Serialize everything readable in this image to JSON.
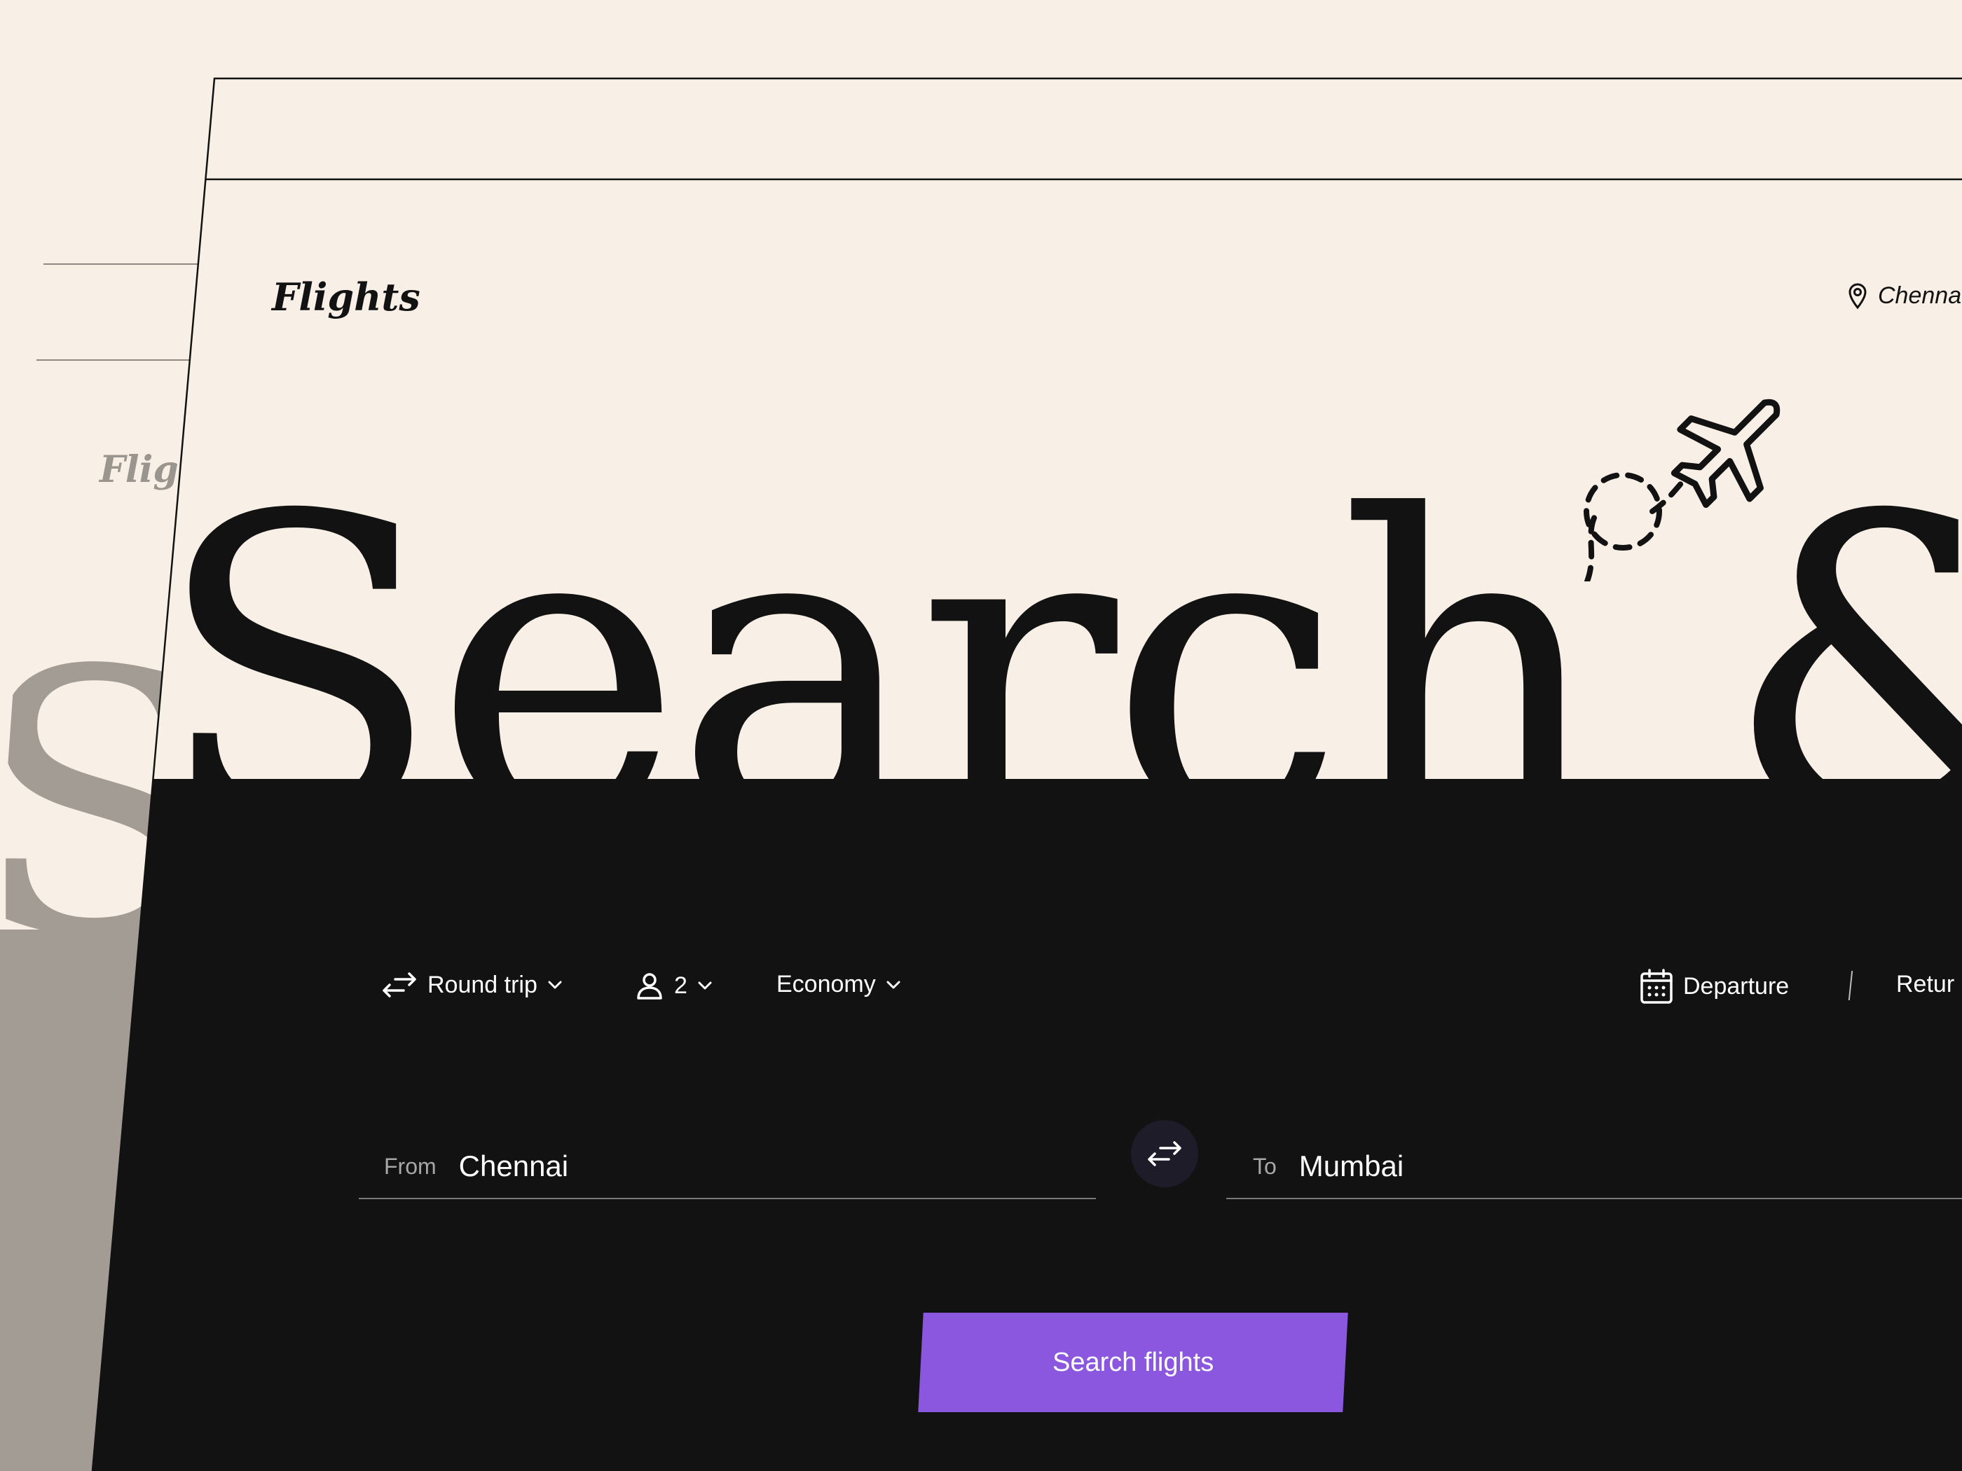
{
  "back_card": {
    "logo_text": "Fligh",
    "hero_text": "S"
  },
  "header": {
    "logo": "Flights",
    "location": "Chenna"
  },
  "hero": {
    "title": "Search & F"
  },
  "search": {
    "trip_type": "Round trip",
    "passengers": "2",
    "cabin_class": "Economy",
    "departure_label": "Departure",
    "return_label": "Retur",
    "from_label": "From",
    "from_value": "Chennai",
    "to_label": "To",
    "to_value": "Mumbai",
    "submit_label": "Search flights"
  },
  "colors": {
    "background": "#f8efe6",
    "dark_panel": "#121212",
    "accent": "#8b57df",
    "swap_button": "#1f1c2a"
  },
  "icons": [
    "swap-icon",
    "person-icon",
    "chevron-down-icon",
    "calendar-icon",
    "location-pin-icon",
    "airplane-icon"
  ]
}
